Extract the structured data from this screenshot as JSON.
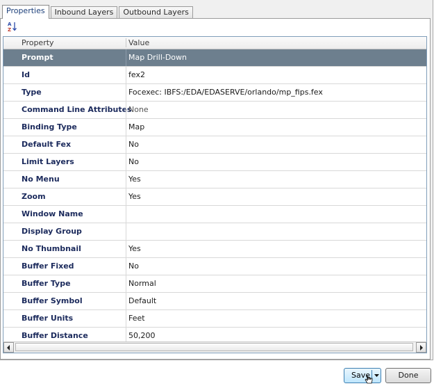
{
  "tabs": [
    {
      "label": "Properties",
      "active": true
    },
    {
      "label": "Inbound Layers",
      "active": false
    },
    {
      "label": "Outbound Layers",
      "active": false
    }
  ],
  "toolbar": {
    "sort_icon": "sort-az-icon"
  },
  "grid": {
    "columns": {
      "property": "Property",
      "value": "Value"
    },
    "rows": [
      {
        "property": "Prompt",
        "value": "Map Drill-Down",
        "selected": true
      },
      {
        "property": "Id",
        "value": "fex2"
      },
      {
        "property": "Type",
        "value": "Focexec: IBFS:/EDA/EDASERVE/orlando/mp_fips.fex"
      },
      {
        "property": "Command Line Attributes",
        "value": "None"
      },
      {
        "property": "Binding Type",
        "value": "Map"
      },
      {
        "property": "Default Fex",
        "value": "No"
      },
      {
        "property": "Limit Layers",
        "value": "No"
      },
      {
        "property": "No Menu",
        "value": "Yes"
      },
      {
        "property": "Zoom",
        "value": "Yes"
      },
      {
        "property": "Window Name",
        "value": ""
      },
      {
        "property": "Display Group",
        "value": ""
      },
      {
        "property": "No Thumbnail",
        "value": "Yes"
      },
      {
        "property": "Buffer Fixed",
        "value": "No"
      },
      {
        "property": "Buffer Type",
        "value": "Normal"
      },
      {
        "property": "Buffer Symbol",
        "value": "Default"
      },
      {
        "property": "Buffer Units",
        "value": "Feet"
      },
      {
        "property": "Buffer Distance",
        "value": "50,200"
      }
    ]
  },
  "buttons": {
    "save": "Save",
    "done": "Done"
  },
  "colors": {
    "selected_row": "#6d7f8e",
    "property_text": "#1b2a5c",
    "grid_border": "#7f9db9"
  }
}
